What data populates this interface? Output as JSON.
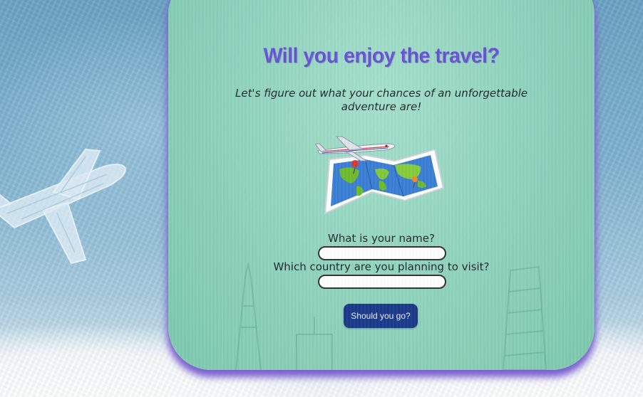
{
  "page": {
    "title": "Will you enjoy the travel?",
    "subtitle": "Let's figure out what your chances of an unforgettable adventure are!"
  },
  "form": {
    "name_label": "What is your name?",
    "name_value": "",
    "country_label": "Which country are you planning to visit?",
    "country_value": "",
    "submit_label": "Should you go?"
  },
  "icons": {
    "illustration": "world-map-airplane-icon",
    "background": "airplane-sketch-icon"
  },
  "colors": {
    "title": "#6a52d6",
    "card": "#8fd3bc",
    "card_shadow": "#7a5fd0",
    "button": "#1b3a8a"
  }
}
